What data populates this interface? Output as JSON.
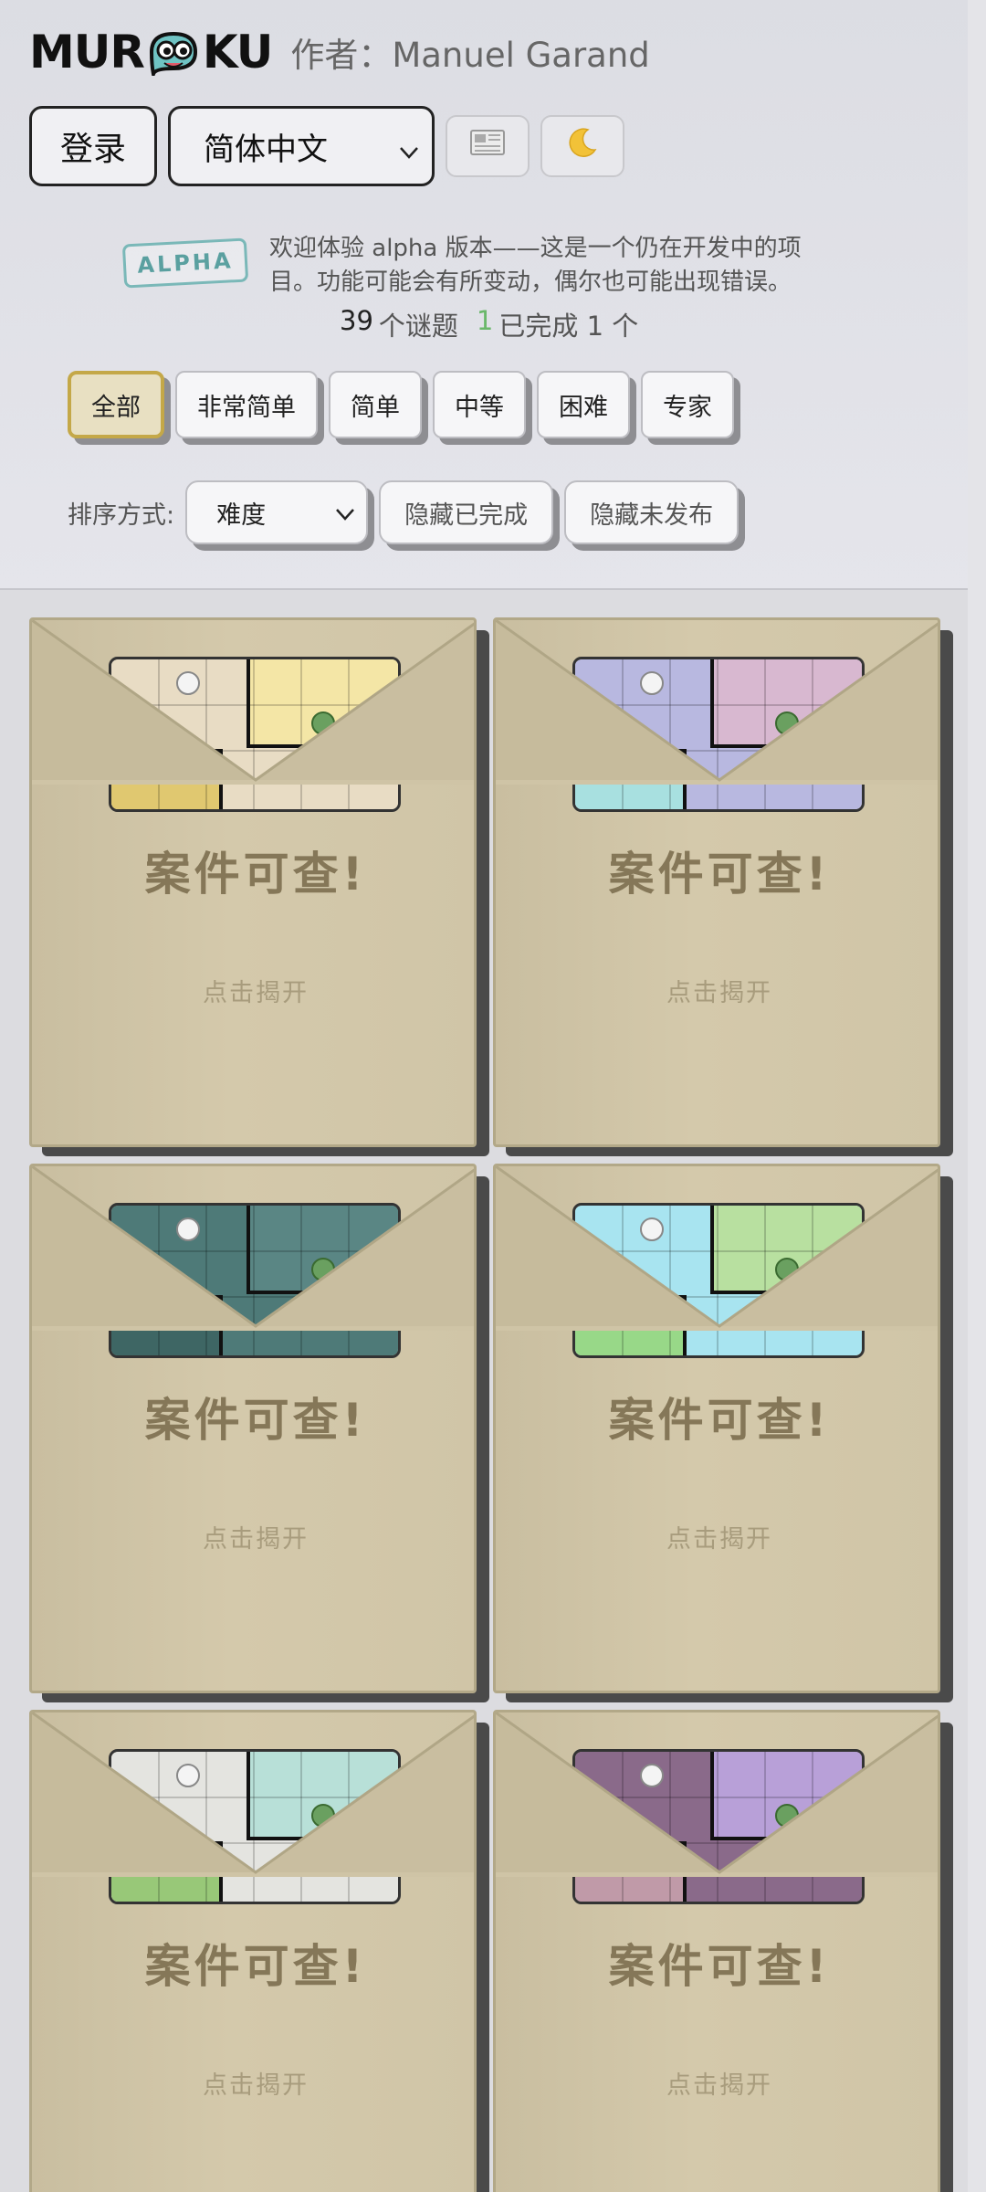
{
  "app": {
    "logo_text_left": "MUR",
    "logo_text_right": "KU",
    "author": "作者：Manuel Garand"
  },
  "toolbar": {
    "login_label": "登录",
    "language_value": "简体中文",
    "news_icon": "newspaper-icon",
    "theme_icon": "moon-icon"
  },
  "notice": {
    "badge": "ALPHA",
    "text": "欢迎体验 alpha 版本——这是一个仍在开发中的项目。功能可能会有所变动，偶尔也可能出现错误。"
  },
  "stats": {
    "total": "39",
    "total_label": "个谜题",
    "done": "1",
    "done_label": "已完成 1 个"
  },
  "filters": [
    {
      "label": "全部",
      "active": true
    },
    {
      "label": "非常简单",
      "active": false
    },
    {
      "label": "简单",
      "active": false
    },
    {
      "label": "中等",
      "active": false
    },
    {
      "label": "困难",
      "active": false
    },
    {
      "label": "专家",
      "active": false
    }
  ],
  "sort": {
    "label": "排序方式:",
    "value": "难度",
    "hide_completed": "隐藏已完成",
    "hide_unreleased": "隐藏未发布"
  },
  "cards": [
    {
      "title": "案件可查!",
      "subtitle": "点击揭开",
      "palette": [
        "#e8dcc4",
        "#f4e6a6",
        "#e0c870"
      ]
    },
    {
      "title": "案件可查!",
      "subtitle": "点击揭开",
      "palette": [
        "#b8b8e0",
        "#d8b8d0",
        "#a8e0e0"
      ]
    },
    {
      "title": "案件可查!",
      "subtitle": "点击揭开",
      "palette": [
        "#4e7a78",
        "#5a8684",
        "#3e6664"
      ]
    },
    {
      "title": "案件可查!",
      "subtitle": "点击揭开",
      "palette": [
        "#a8e4f0",
        "#b8e0a0",
        "#98d888"
      ]
    },
    {
      "title": "案件可查!",
      "subtitle": "点击揭开",
      "palette": [
        "#e4e4e0",
        "#b8e0d8",
        "#98c878"
      ]
    },
    {
      "title": "案件可查!",
      "subtitle": "点击揭开",
      "palette": [
        "#8a6a8a",
        "#b8a0d8",
        "#c09aa8"
      ]
    }
  ]
}
